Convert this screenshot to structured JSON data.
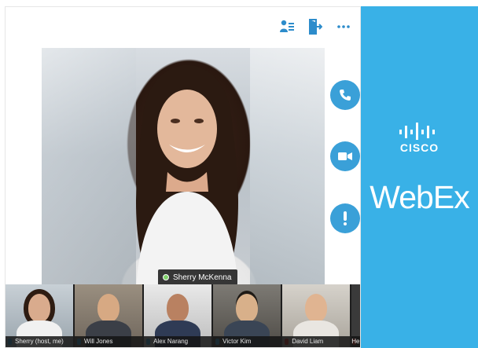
{
  "toolbar": {
    "icons": [
      "participants-icon",
      "leave-icon",
      "more-icon"
    ]
  },
  "main_video": {
    "speaker_name": "Sherry McKenna"
  },
  "actions": {
    "icons": [
      "phone-icon",
      "video-icon",
      "alert-icon"
    ],
    "accent": "#3aa0d8"
  },
  "filmstrip": {
    "tiles": [
      {
        "label": "Sherry (host, me)",
        "mic": "active"
      },
      {
        "label": "Will Jones",
        "mic": "active"
      },
      {
        "label": "Alex Narang",
        "mic": "active"
      },
      {
        "label": "Victor Kim",
        "mic": "active"
      },
      {
        "label": "David Liam",
        "mic": "muted"
      },
      {
        "label": "He",
        "mic": "muted"
      }
    ]
  },
  "brand": {
    "company": "CISCO",
    "product": "WebEx",
    "color": "#39b1e7"
  }
}
